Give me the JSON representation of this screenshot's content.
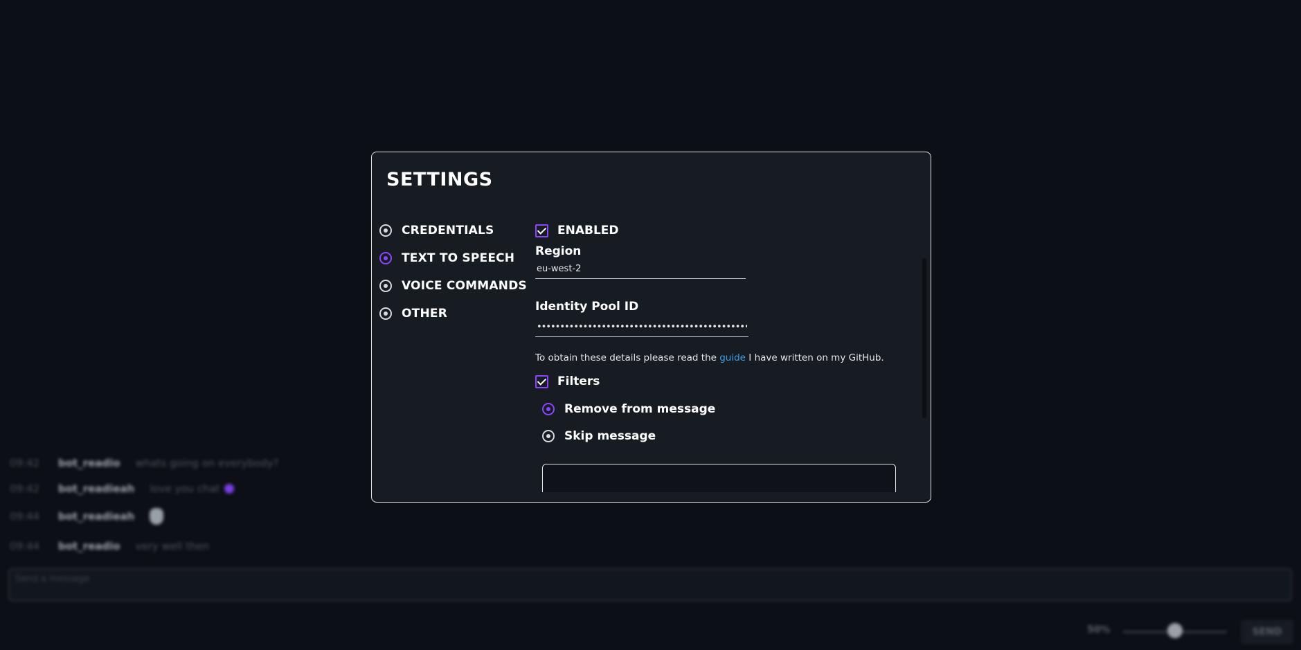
{
  "chat": {
    "messages": [
      {
        "time": "09:42",
        "user": "bot_readio",
        "text": "whats going on everybody?"
      },
      {
        "time": "09:42",
        "user": "bot_readieah",
        "text": "love you chat",
        "emote": "heart-emote"
      },
      {
        "time": "09:44",
        "user": "bot_readieah",
        "text": "",
        "emote": "hand-emote"
      },
      {
        "time": "09:44",
        "user": "bot_readio",
        "text": "very well then"
      }
    ],
    "input_placeholder": "Send a message",
    "volume_label": "50%",
    "volume": 0.5,
    "send_label": "SEND"
  },
  "settings": {
    "title": "SETTINGS",
    "nav": [
      {
        "label": "CREDENTIALS",
        "active": false
      },
      {
        "label": "TEXT TO SPEECH",
        "active": true
      },
      {
        "label": "VOICE COMMANDS",
        "active": false
      },
      {
        "label": "OTHER",
        "active": false
      }
    ],
    "enabled_label": "ENABLED",
    "enabled": true,
    "region_label": "Region",
    "region_value": "eu-west-2",
    "identity_pool_label": "Identity Pool ID",
    "identity_pool_value": "••••••••••••••••••••••••••••••••••••••••••••••",
    "help_prefix": "To obtain these details please read the",
    "help_link": "guide",
    "help_suffix": "I have written on my GitHub.",
    "filters_label": "Filters",
    "filters_enabled": true,
    "filter_modes": [
      {
        "label": "Remove from message",
        "selected": true
      },
      {
        "label": "Skip message",
        "selected": false
      }
    ]
  },
  "colors": {
    "accent": "#8b45ff",
    "link": "#3aa0e8",
    "modal_bg": "#171b22",
    "page_bg": "#0c0f15"
  }
}
